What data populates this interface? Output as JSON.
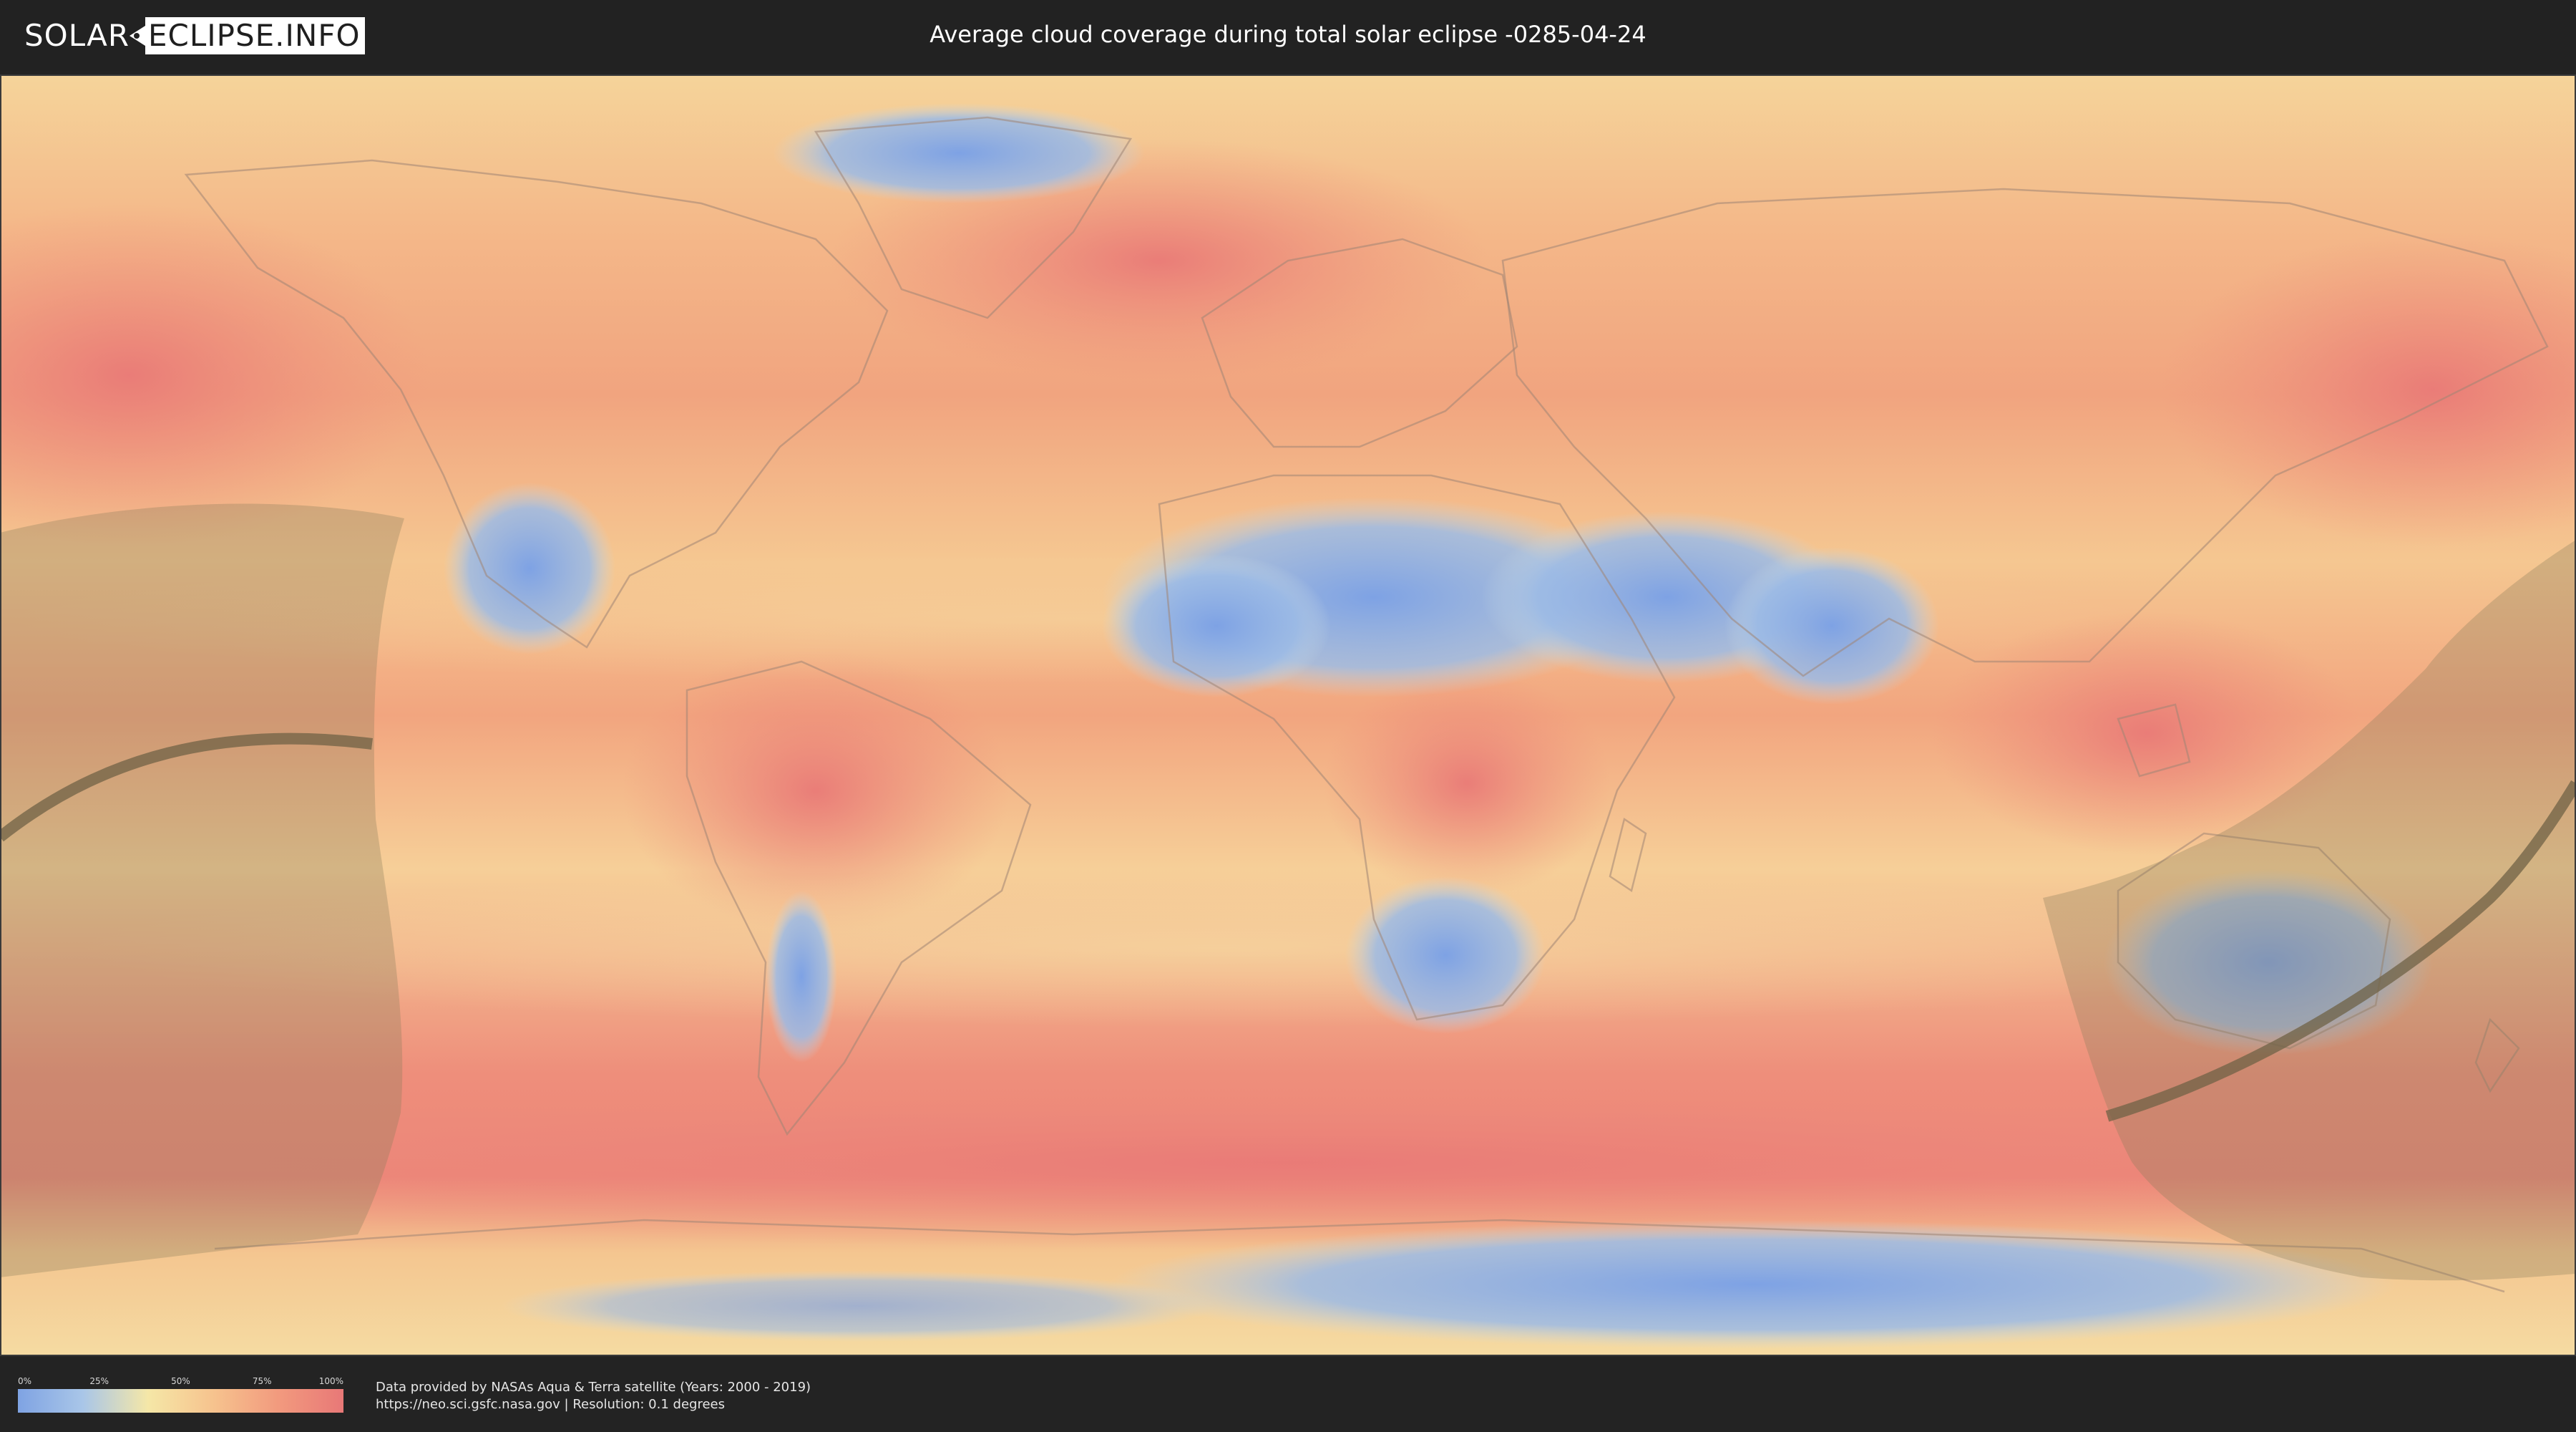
{
  "header": {
    "logo_left": "SOLAR",
    "logo_right": "ECLIPSE.INFO",
    "title": "Average cloud coverage during total solar eclipse -0285-04-24"
  },
  "legend": {
    "ticks": [
      "0%",
      "25%",
      "50%",
      "75%",
      "100%"
    ],
    "stops": [
      0,
      0.25,
      0.5,
      0.75,
      1.0
    ],
    "colors": [
      "#7fa3e3",
      "#a9c6e8",
      "#f5e7a7",
      "#f6c38e",
      "#f29a7e",
      "#e87877"
    ]
  },
  "credit": {
    "line1": "Data provided by NASAs Aqua & Terra satellite (Years: 2000 - 2019)",
    "line2": "https://neo.sci.gsfc.nasa.gov | Resolution: 0.1 degrees"
  },
  "map": {
    "ocean_color": "#f3a07e",
    "dry_color": "#86a8e6",
    "mid_color": "#f6d9a0",
    "eclipse_shadow_color": "#8a7b5a",
    "eclipse_path_color": "#6f6146"
  }
}
